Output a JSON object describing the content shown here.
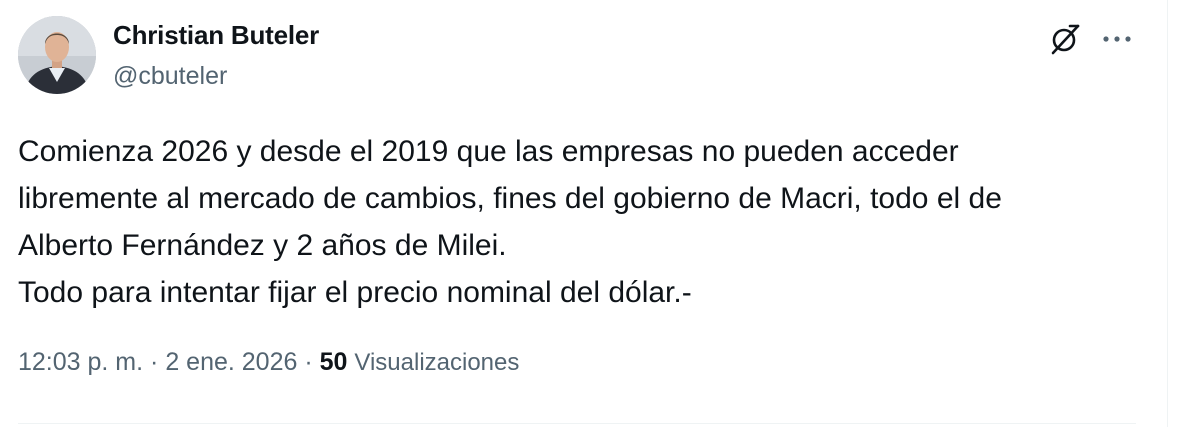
{
  "author": {
    "name": "Christian Buteler",
    "handle": "@cbuteler"
  },
  "tweet": {
    "lines": [
      "Comienza 2026 y desde el 2019 que las empresas no pueden acceder",
      "libremente al mercado de cambios, fines del gobierno de Macri, todo el de",
      "Alberto Fernández y 2 años de Milei.",
      "Todo para intentar fijar el precio nominal del dólar.-"
    ]
  },
  "meta": {
    "time": "12:03 p. m.",
    "separator": "·",
    "date": "2 ene. 2026",
    "views_count": "50",
    "views_label": "Visualizaciones"
  },
  "icons": {
    "grok": "grok-icon",
    "more": "more-icon"
  },
  "colors": {
    "text": "#0f1419",
    "secondary": "#536471",
    "border": "#eff3f4"
  }
}
